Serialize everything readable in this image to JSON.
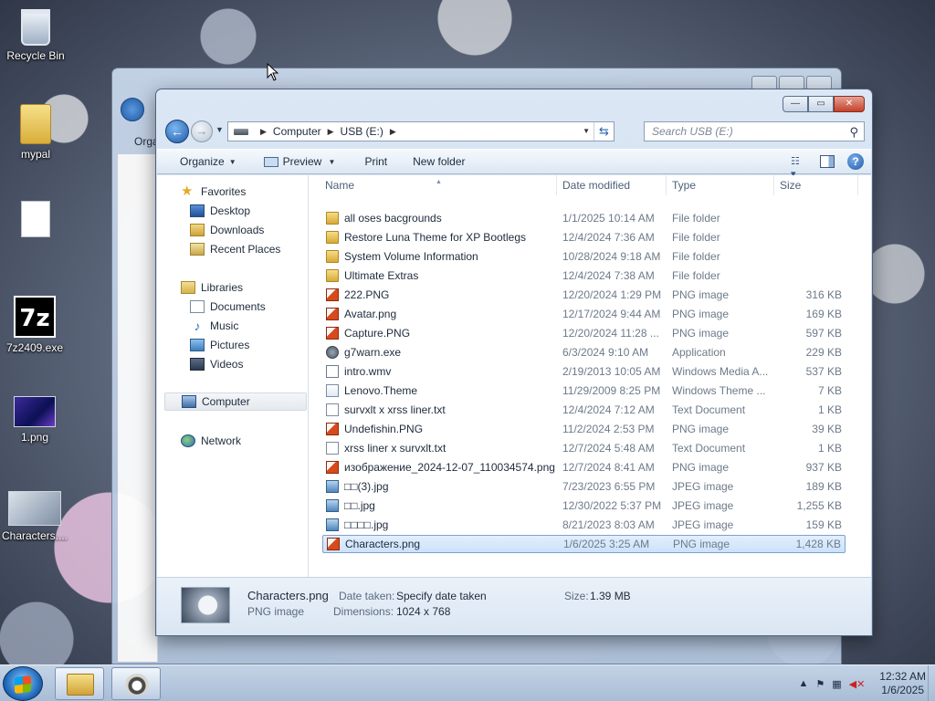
{
  "desktop": {
    "icons": [
      {
        "label": "Recycle Bin",
        "icon": "recycle-bin-icon"
      },
      {
        "label": "mypal",
        "icon": "folder-icon"
      },
      {
        "label": "",
        "icon": "blank-file-icon"
      },
      {
        "label": "7z2409.exe",
        "icon": "7zip-icon"
      },
      {
        "label": "1.png",
        "icon": "image-icon"
      },
      {
        "label": "Characters....",
        "icon": "image-icon"
      }
    ]
  },
  "background_window": {
    "organize_label": "Orga"
  },
  "window": {
    "address": {
      "parts": [
        "Computer",
        "USB (E:)"
      ]
    },
    "search_placeholder": "Search USB (E:)",
    "toolbar": {
      "organize": "Organize",
      "preview": "Preview",
      "print": "Print",
      "new_folder": "New folder"
    },
    "nav": {
      "favorites": "Favorites",
      "desktop": "Desktop",
      "downloads": "Downloads",
      "recent": "Recent Places",
      "libraries": "Libraries",
      "documents": "Documents",
      "music": "Music",
      "pictures": "Pictures",
      "videos": "Videos",
      "computer": "Computer",
      "network": "Network"
    },
    "columns": {
      "name": "Name",
      "date": "Date modified",
      "type": "Type",
      "size": "Size"
    },
    "files": [
      {
        "name": "all oses bacgrounds",
        "date": "1/1/2025 10:14 AM",
        "type": "File folder",
        "size": "",
        "icon": "folder"
      },
      {
        "name": "Restore Luna Theme for XP Bootlegs",
        "date": "12/4/2024 7:36 AM",
        "type": "File folder",
        "size": "",
        "icon": "folder"
      },
      {
        "name": "System Volume Information",
        "date": "10/28/2024 9:18 AM",
        "type": "File folder",
        "size": "",
        "icon": "folder"
      },
      {
        "name": "Ultimate Extras",
        "date": "12/4/2024 7:38 AM",
        "type": "File folder",
        "size": "",
        "icon": "folder"
      },
      {
        "name": "222.PNG",
        "date": "12/20/2024 1:29 PM",
        "type": "PNG image",
        "size": "316 KB",
        "icon": "png"
      },
      {
        "name": "Avatar.png",
        "date": "12/17/2024 9:44 AM",
        "type": "PNG image",
        "size": "169 KB",
        "icon": "png"
      },
      {
        "name": "Capture.PNG",
        "date": "12/20/2024 11:28 ...",
        "type": "PNG image",
        "size": "597 KB",
        "icon": "png"
      },
      {
        "name": "g7warn.exe",
        "date": "6/3/2024 9:10 AM",
        "type": "Application",
        "size": "229 KB",
        "icon": "exe"
      },
      {
        "name": "intro.wmv",
        "date": "2/19/2013 10:05 AM",
        "type": "Windows Media A...",
        "size": "537 KB",
        "icon": "wmv"
      },
      {
        "name": "Lenovo.Theme",
        "date": "11/29/2009 8:25 PM",
        "type": "Windows Theme ...",
        "size": "7 KB",
        "icon": "theme"
      },
      {
        "name": "survxlt x xrss liner.txt",
        "date": "12/4/2024 7:12 AM",
        "type": "Text Document",
        "size": "1 KB",
        "icon": "txt"
      },
      {
        "name": "Undefishin.PNG",
        "date": "11/2/2024 2:53 PM",
        "type": "PNG image",
        "size": "39 KB",
        "icon": "png"
      },
      {
        "name": "xrss liner x survxlt.txt",
        "date": "12/7/2024 5:48 AM",
        "type": "Text Document",
        "size": "1 KB",
        "icon": "txt"
      },
      {
        "name": "изображение_2024-12-07_110034574.png",
        "date": "12/7/2024 8:41 AM",
        "type": "PNG image",
        "size": "937 KB",
        "icon": "png"
      },
      {
        "name": "□□(3).jpg",
        "date": "7/23/2023 6:55 PM",
        "type": "JPEG image",
        "size": "189 KB",
        "icon": "jpg"
      },
      {
        "name": "□□.jpg",
        "date": "12/30/2022 5:37 PM",
        "type": "JPEG image",
        "size": "1,255 KB",
        "icon": "jpg"
      },
      {
        "name": "□□□□.jpg",
        "date": "8/21/2023 8:03 AM",
        "type": "JPEG image",
        "size": "159 KB",
        "icon": "jpg"
      },
      {
        "name": "Characters.png",
        "date": "1/6/2025 3:25 AM",
        "type": "PNG image",
        "size": "1,428 KB",
        "icon": "png",
        "selected": true
      }
    ],
    "details": {
      "name": "Characters.png",
      "type": "PNG image",
      "date_taken_label": "Date taken:",
      "date_taken_value": "Specify date taken",
      "dimensions_label": "Dimensions:",
      "dimensions_value": "1024 x 768",
      "size_label": "Size:",
      "size_value": "1.39 MB"
    }
  },
  "taskbar": {
    "time": "12:32 AM",
    "date": "1/6/2025"
  }
}
